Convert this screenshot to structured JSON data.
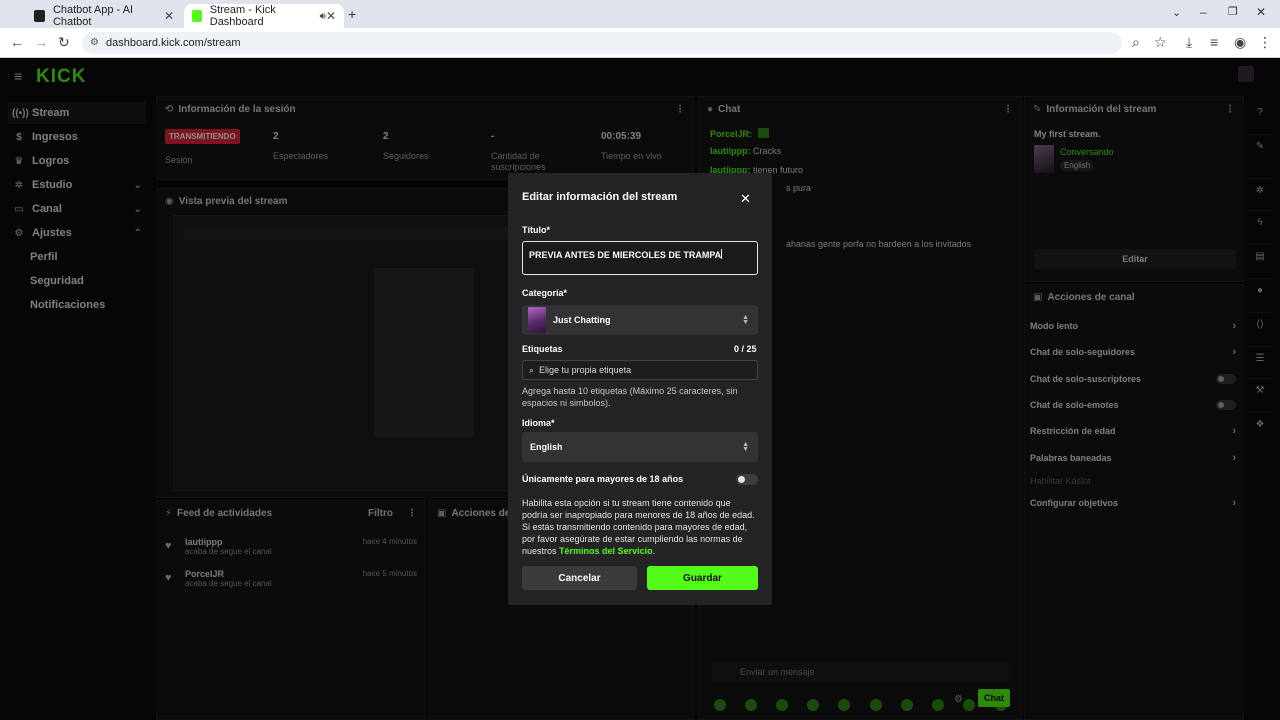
{
  "browser": {
    "tabs": [
      {
        "label": "Chatbot App - AI Chatbot",
        "active": false
      },
      {
        "label": "Stream - Kick Dashboard",
        "active": true
      }
    ],
    "url": "dashboard.kick.com/stream"
  },
  "sidebar": {
    "logo": "KICK",
    "items": [
      {
        "label": "Stream",
        "icon": "signal-icon"
      },
      {
        "label": "Ingresos",
        "icon": "money-icon"
      },
      {
        "label": "Logros",
        "icon": "trophy-icon"
      },
      {
        "label": "Estudio",
        "icon": "gear-icon"
      },
      {
        "label": "Canal",
        "icon": "screen-icon"
      },
      {
        "label": "Ajustes",
        "icon": "gear-icon"
      }
    ],
    "subitems": [
      "Perfil",
      "Seguridad",
      "Notificaciones"
    ]
  },
  "session": {
    "title": "Información de la sesión",
    "status_badge": "TRANSMITIENDO",
    "status_label": "Sesión",
    "stats": [
      {
        "value": "2",
        "label": "Espectadores"
      },
      {
        "value": "2",
        "label": "Seguidores"
      },
      {
        "value": "-",
        "label": "Cantidad de suscripciones"
      },
      {
        "value": "00:05:39",
        "label": "Tiempo en vivo"
      }
    ]
  },
  "preview": {
    "title": "Vista previa del stream"
  },
  "feed": {
    "title": "Feed de actividades",
    "filter": "Filtro",
    "items": [
      {
        "name": "lautiippp",
        "action": "acaba de segue el canal",
        "time": "hace 4 minutos"
      },
      {
        "name": "PorcelJR",
        "action": "acaba de segue el canal",
        "time": "hace 5 minutos"
      }
    ]
  },
  "mod_actions": {
    "title": "Acciones de m"
  },
  "chat": {
    "title": "Chat",
    "messages": [
      {
        "user": "PorcelJR:",
        "text": ""
      },
      {
        "user": "lautiippp:",
        "text": "Cracks"
      },
      {
        "user": "lautiippp:",
        "text": "tienen futuro"
      },
      {
        "user": "",
        "text": "s pura"
      },
      {
        "user": "",
        "text": "ahanas gente porfa no bardeen a los invitados"
      }
    ],
    "input_placeholder": "Enviar un mensaje",
    "send_label": "Chat"
  },
  "stream_info": {
    "title": "Información del stream",
    "stream_title": "My first stream.",
    "category": "Conversando",
    "language": "English",
    "edit_label": "Editar"
  },
  "channel_actions": {
    "title": "Acciones de canal",
    "items": [
      {
        "label": "Modo lento",
        "control": "arrow"
      },
      {
        "label": "Chat de solo-seguidores",
        "control": "arrow"
      },
      {
        "label": "Chat de solo-suscriptores",
        "control": "toggle"
      },
      {
        "label": "Chat de solo-emotes",
        "control": "toggle"
      },
      {
        "label": "Restricción de edad",
        "control": "arrow"
      },
      {
        "label": "Palabras baneadas",
        "control": "arrow"
      },
      {
        "label": "Habilitar Kaslot",
        "control": "none"
      },
      {
        "label": "Configurar objetivos",
        "control": "arrow"
      }
    ]
  },
  "modal": {
    "title": "Editar información del stream",
    "title_label": "Título*",
    "title_value": "PREVIA ANTES DE MIERCOLES DE TRAMPA",
    "category_label": "Categoría*",
    "category_value": "Just Chatting",
    "tags_label": "Etiquetas",
    "tags_count": "0 / 25",
    "tags_placeholder": "Elige tu propia etiqueta",
    "tags_help": "Agrega hasta 10 etiquetas (Máximo 25 caracteres, sin espacios ni simbolos).",
    "language_label": "Idioma*",
    "language_value": "English",
    "adult_label": "Únicamente para mayores de 18 años",
    "adult_help": "Habilita esta opción si tu stream tiene contenido que podría ser inapropiado para menores de 18 años de edad. Si estás transmitiendo contenido para mayores de edad, por favor asegúrate de estar cumpliendo las normas de nuestros",
    "terms_link": "Términos del Servicio",
    "cancel_label": "Cancelar",
    "save_label": "Guardar"
  },
  "colors": {
    "kick_green": "#53fc18",
    "live_red": "#e3263b",
    "modal_bg": "#242427"
  }
}
